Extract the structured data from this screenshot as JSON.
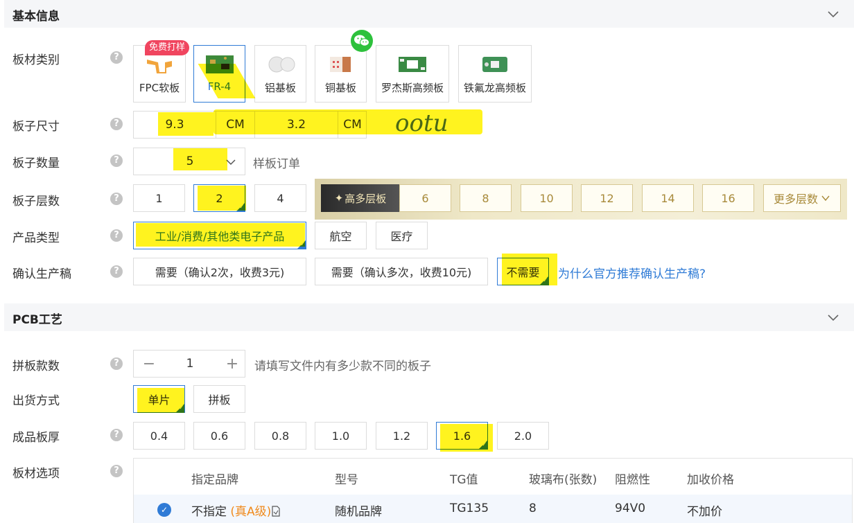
{
  "basic": {
    "title": "基本信息",
    "labels": {
      "material": "板材类别",
      "size": "板子尺寸",
      "quantity": "板子数量",
      "layers": "板子层数",
      "product_type": "产品类型",
      "confirm": "确认生产稿"
    },
    "free_tag": "免费打样",
    "materials": [
      "FPC软板",
      "FR-4",
      "铝基板",
      "铜基板",
      "罗杰斯高频板",
      "铁氟龙高频板"
    ],
    "size": {
      "width": "9.3",
      "height": "3.2",
      "unit": "CM"
    },
    "handwriting": "ootu",
    "quantity": {
      "value": "5",
      "hint": "样板订单"
    },
    "layers": [
      "1",
      "2",
      "4"
    ],
    "high_layers_label": "高多层板",
    "high_layers": [
      "6",
      "8",
      "10",
      "12",
      "14",
      "16"
    ],
    "more_layers": "更多层数",
    "product_types": [
      "工业/消费/其他类电子产品",
      "航空",
      "医疗"
    ],
    "confirm_options": [
      "需要（确认2次，收费3元)",
      "需要（确认多次，收费10元)",
      "不需要"
    ],
    "confirm_link": "为什么官方推荐确认生产稿?"
  },
  "pcb": {
    "title": "PCB工艺",
    "labels": {
      "panel_count": "拼板款数",
      "ship": "出货方式",
      "thickness": "成品板厚",
      "material_opt": "板材选项"
    },
    "panel_count": {
      "minus": "−",
      "value": "1",
      "plus": "+",
      "hint": "请填写文件内有多少款不同的板子"
    },
    "ship_options": [
      "单片",
      "拼板"
    ],
    "thickness_options": [
      "0.4",
      "0.6",
      "0.8",
      "1.0",
      "1.2",
      "1.6",
      "2.0"
    ],
    "table": {
      "headers": [
        "指定品牌",
        "型号",
        "TG值",
        "玻璃布(张数)",
        "阻燃性",
        "加收价格"
      ],
      "row": {
        "brand": "不指定",
        "grade": "(真A级)",
        "model": "随机品牌",
        "tg": "TG135",
        "glass": "8",
        "flame": "94V0",
        "price": "不加价"
      }
    }
  },
  "colors": {
    "accent": "#2f7bd6",
    "highlight": "#fff200",
    "gold": "#a88a3a",
    "tag": "#f0455f"
  }
}
